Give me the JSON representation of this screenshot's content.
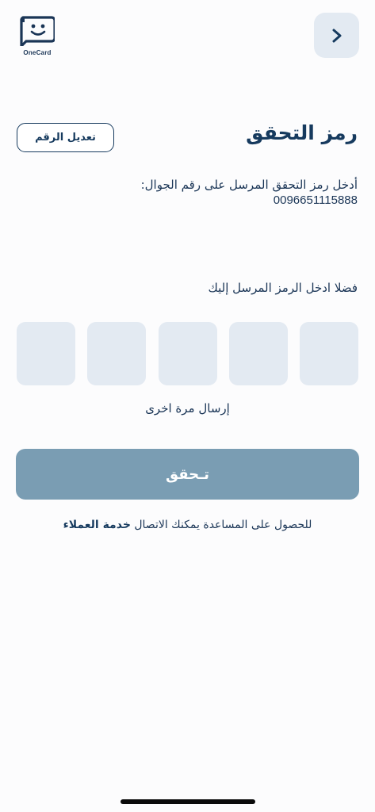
{
  "logo": {
    "text": "OneCard",
    "icon": "onecard-smiley-icon"
  },
  "header": {
    "back_icon": "chevron-right-icon"
  },
  "title": "رمز التحقق",
  "edit_number_label": "تعديل الرقم",
  "instruction": "أدخل رمز التحقق المرسل على رقم الجوال:",
  "phone_number": "0096651115888",
  "otp_prompt": "فضلا ادخل الرمز المرسل إليك",
  "otp": {
    "digits": [
      "",
      "",
      "",
      "",
      ""
    ]
  },
  "resend_label": "إرسال مرة اخرى",
  "verify_label": "تـحقق",
  "help": {
    "text": "للحصول على المساعدة يمكنك الاتصال",
    "link": "خدمة العملاء"
  },
  "colors": {
    "primary": "#163a5e",
    "button_disabled": "#7a9db3",
    "input_bg": "#e3eaf2"
  }
}
